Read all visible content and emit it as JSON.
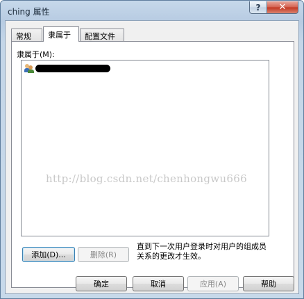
{
  "window": {
    "title": "ching 属性",
    "help_glyph": "?",
    "close_glyph": "✕"
  },
  "tabs": [
    {
      "label": "常规",
      "active": false
    },
    {
      "label": "隶属于",
      "active": true
    },
    {
      "label": "配置文件",
      "active": false
    }
  ],
  "member_of": {
    "label": "隶属于(M):",
    "items": [
      {
        "icon": "group-icon",
        "name": "████████████",
        "redacted": true
      }
    ]
  },
  "watermark": "http://blog.csdn.net/chenhongwu666",
  "buttons": {
    "add": "添加(D)...",
    "remove": "删除(R)",
    "ok": "确定",
    "cancel": "取消",
    "apply": "应用(A)",
    "help": "帮助"
  },
  "note": "直到下一次用户登录时对用户的组成员关系的更改才生效。",
  "colors": {
    "title_bar": "#c6d8ea",
    "close_button": "#c2351f",
    "dialog_bg": "#f0f0f0"
  }
}
